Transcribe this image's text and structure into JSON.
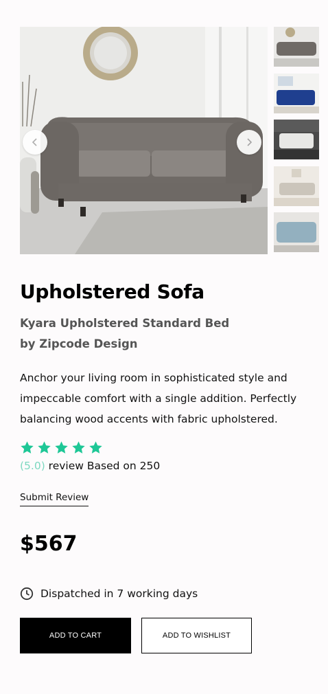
{
  "product": {
    "title": "Upholstered Sofa",
    "subtitle": "Kyara Upholstered Standard Bed by Zipcode Design",
    "description": "Anchor your living room in sophisticated style and impeccable comfort with a single addition. Perfectly balancing wood accents with fabric upholstered.",
    "rating_value": "(5.0)",
    "rating_text": " review Based on 250",
    "stars": 5,
    "submit_review": "Submit Review",
    "price": "$567",
    "dispatch": "Dispatched in 7 working days"
  },
  "actions": {
    "add_to_cart": "ADD TO CART",
    "add_to_wishlist": "ADD TO WISHLIST"
  },
  "gallery": {
    "main_image": "grey-tufted-sofa-photo",
    "thumbnails": [
      "grey-sofa-thumb",
      "blue-sofa-thumb",
      "white-sofa-thumb",
      "beige-sofa-thumb",
      "light-blue-sofa-thumb"
    ]
  },
  "colors": {
    "star": "#1ec796",
    "rating_accent": "#7dd8c0",
    "primary_button": "#000000"
  }
}
